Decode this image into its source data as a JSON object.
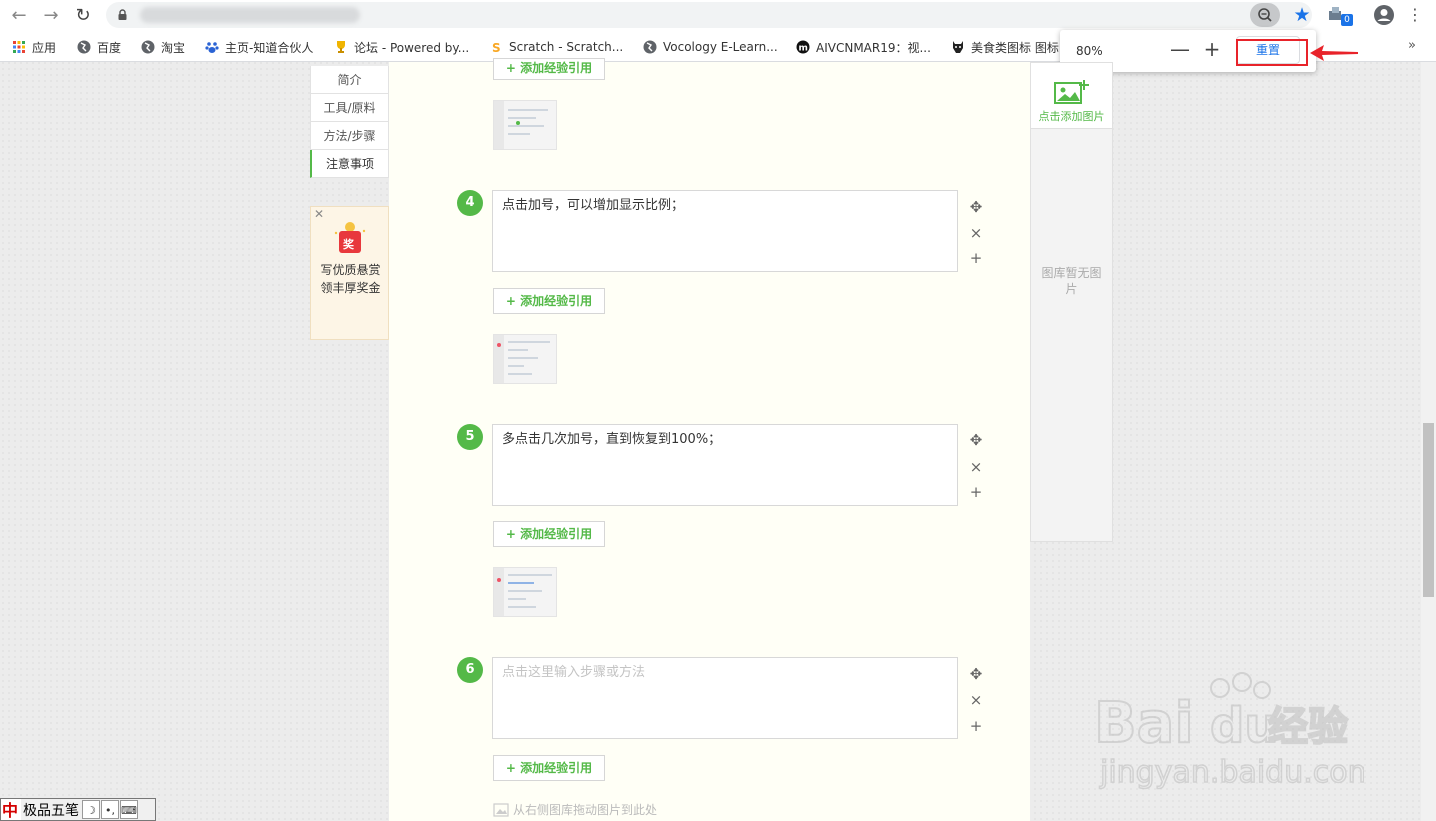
{
  "browser": {
    "bookmarks": [
      {
        "label": "应用"
      },
      {
        "label": "百度"
      },
      {
        "label": "淘宝"
      },
      {
        "label": "主页-知道合伙人"
      },
      {
        "label": "论坛 - Powered by..."
      },
      {
        "label": "Scratch - Scratch..."
      },
      {
        "label": "Vocology E-Learn..."
      },
      {
        "label": "AIVCNMAR19：视..."
      },
      {
        "label": "美食类图标 图标"
      }
    ],
    "more_bookmarks": "»",
    "extension_badge": "0",
    "zoom_popup": {
      "level": "80%",
      "minus": "—",
      "plus": "+",
      "reset_label": "重置"
    }
  },
  "colors": {
    "accent": "#54b948",
    "highlight": "#e8232a",
    "link": "#1a73e8"
  },
  "left_nav": {
    "items": [
      "简介",
      "工具/原料",
      "方法/步骤",
      "注意事项"
    ],
    "active_index": 3
  },
  "reward": {
    "close": "✕",
    "line1": "写优质悬赏",
    "line2": "领丰厚奖金",
    "badge": "奖"
  },
  "editor": {
    "cite_label": "添加经验引用",
    "cite_plus": "+",
    "steps": [
      {
        "number": "4",
        "text": "点击加号，可以增加显示比例；"
      },
      {
        "number": "5",
        "text": "多点击几次加号，直到恢复到100%；"
      },
      {
        "number": "6",
        "text": "",
        "placeholder": "点击这里输入步骤或方法"
      }
    ],
    "tools": {
      "move": "✥",
      "delete": "×",
      "add": "+"
    },
    "drag_hint": "从右侧图库拖动图片到此处"
  },
  "gallery": {
    "add_label": "点击添加图片",
    "empty_text": "图库暂无图片"
  },
  "ime": {
    "logo": "中",
    "name": "极品五笔",
    "moon": "☽",
    "punct": "•,",
    "keyboard": "⌨"
  },
  "watermark": {
    "brand_left": "Bai",
    "brand_right": "du",
    "brand_cn": "经验",
    "url": "jingyan.baidu.com"
  }
}
